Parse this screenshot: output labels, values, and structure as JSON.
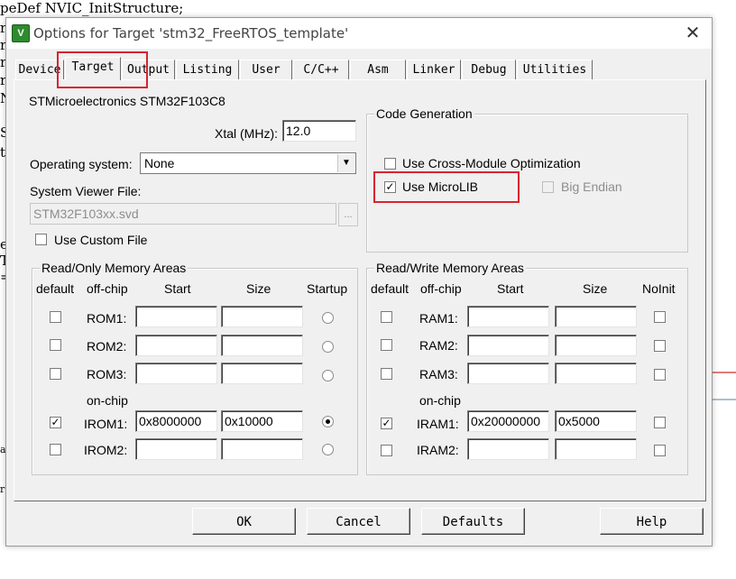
{
  "editor": {
    "lines": [
      "peDef NVIC_InitStructure;",
      "r",
      "r",
      "r",
      "r",
      "N",
      "S",
      "t",
      "e",
      "T",
      "=",
      "a",
      "r"
    ]
  },
  "dialog": {
    "icon_glyph": "V",
    "title": "Options for Target 'stm32_FreeRTOS_template'",
    "close_glyph": "✕"
  },
  "tabs": [
    "Device",
    "Target",
    "Output",
    "Listing",
    "User",
    "C/C++",
    "Asm",
    "Linker",
    "Debug",
    "Utilities"
  ],
  "active_tab": "Target",
  "target": {
    "device_name": "STMicroelectronics STM32F103C8",
    "xtal_label": "Xtal (MHz):",
    "xtal_value": "12.0",
    "os_label": "Operating system:",
    "os_value": "None",
    "svd_label": "System Viewer File:",
    "svd_value": "STM32F103xx.svd",
    "browse_label": "...",
    "use_custom_file": "Use Custom File"
  },
  "code_generation": {
    "title": "Code Generation",
    "cross_module": "Use Cross-Module Optimization",
    "microlib": "Use MicroLIB",
    "big_endian": "Big Endian",
    "microlib_checked": true
  },
  "ro_memory": {
    "title": "Read/Only Memory Areas",
    "headers": [
      "default",
      "off-chip",
      "Start",
      "Size",
      "Startup"
    ],
    "onchip_label": "on-chip",
    "rows": [
      {
        "name": "ROM1:",
        "start": "",
        "size": "",
        "default": false,
        "startup": false
      },
      {
        "name": "ROM2:",
        "start": "",
        "size": "",
        "default": false,
        "startup": false
      },
      {
        "name": "ROM3:",
        "start": "",
        "size": "",
        "default": false,
        "startup": false
      },
      {
        "name": "IROM1:",
        "start": "0x8000000",
        "size": "0x10000",
        "default": true,
        "startup": true
      },
      {
        "name": "IROM2:",
        "start": "",
        "size": "",
        "default": false,
        "startup": false
      }
    ]
  },
  "rw_memory": {
    "title": "Read/Write Memory Areas",
    "headers": [
      "default",
      "off-chip",
      "Start",
      "Size",
      "NoInit"
    ],
    "onchip_label": "on-chip",
    "rows": [
      {
        "name": "RAM1:",
        "start": "",
        "size": "",
        "default": false,
        "noinit": false
      },
      {
        "name": "RAM2:",
        "start": "",
        "size": "",
        "default": false,
        "noinit": false
      },
      {
        "name": "RAM3:",
        "start": "",
        "size": "",
        "default": false,
        "noinit": false
      },
      {
        "name": "IRAM1:",
        "start": "0x20000000",
        "size": "0x5000",
        "default": true,
        "noinit": false
      },
      {
        "name": "IRAM2:",
        "start": "",
        "size": "",
        "default": false,
        "noinit": false
      }
    ]
  },
  "buttons": {
    "ok": "OK",
    "cancel": "Cancel",
    "defaults": "Defaults",
    "help": "Help"
  },
  "check_glyph": "✓",
  "colors": {
    "highlight": "#d9232f",
    "dialog_bg": "#f0f0f0"
  }
}
